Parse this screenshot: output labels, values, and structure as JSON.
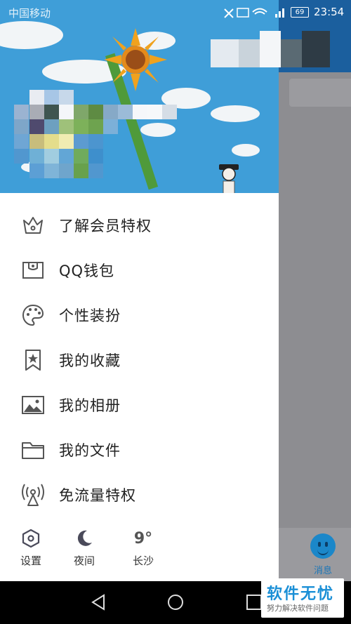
{
  "status_bar": {
    "carrier": "中国移动",
    "time": "23:54",
    "battery": "69"
  },
  "menu": {
    "items": [
      {
        "label": "了解会员特权",
        "icon": "crown-icon"
      },
      {
        "label": "QQ钱包",
        "icon": "wallet-icon"
      },
      {
        "label": "个性装扮",
        "icon": "palette-icon"
      },
      {
        "label": "我的收藏",
        "icon": "bookmark-star-icon"
      },
      {
        "label": "我的相册",
        "icon": "photo-album-icon"
      },
      {
        "label": "我的文件",
        "icon": "folder-icon"
      },
      {
        "label": "免流量特权",
        "icon": "signal-tower-icon"
      }
    ]
  },
  "bottom_bar": {
    "settings_label": "设置",
    "night_label": "夜间",
    "weather_temp": "9°",
    "weather_city": "长沙"
  },
  "main_tab": {
    "messages_label": "消息"
  },
  "watermark": {
    "title": "软件无忧",
    "subtitle": "努力解决软件问题"
  },
  "colors": {
    "accent": "#1b87c9",
    "header": "#1b5f9e",
    "cover_sky": "#3f9ed8"
  }
}
